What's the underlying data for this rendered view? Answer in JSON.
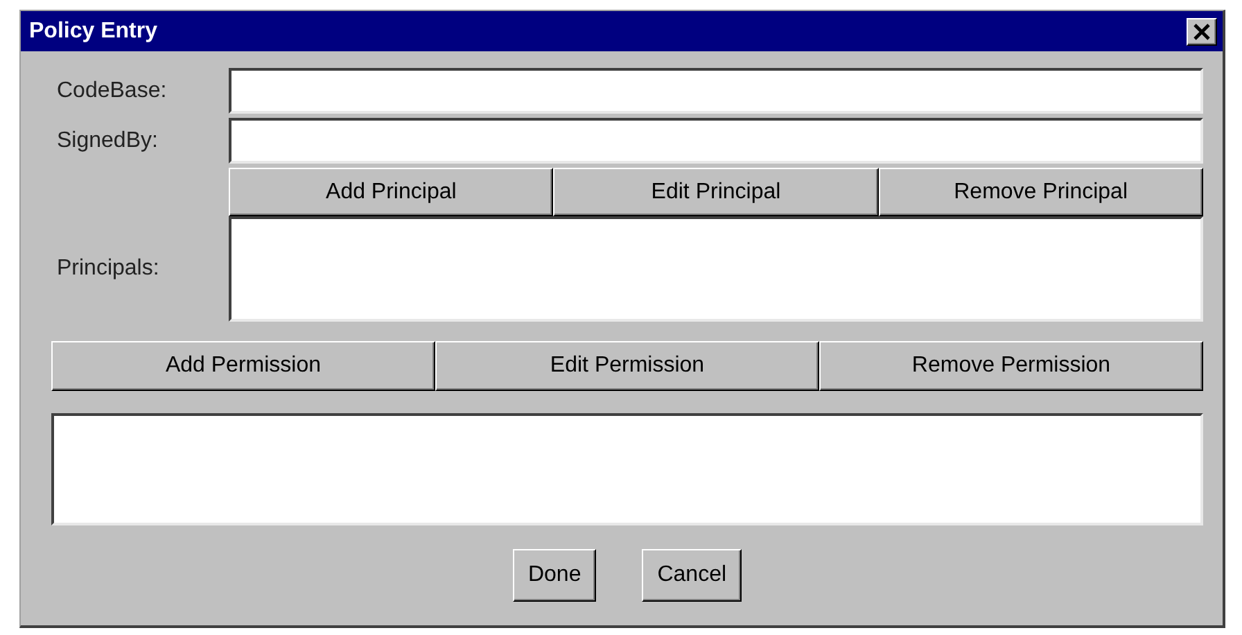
{
  "window": {
    "title": "Policy Entry"
  },
  "fields": [
    {
      "label": "CodeBase:"
    },
    {
      "label": "SignedBy:"
    }
  ],
  "principal_buttons": [
    "Add Principal",
    "Edit Principal",
    "Remove Principal"
  ],
  "principals": {
    "label": "Principals:"
  },
  "permission_buttons": [
    "Add Permission",
    "Edit Permission",
    "Remove Permission"
  ],
  "dialog_buttons": [
    "Done",
    "Cancel"
  ]
}
